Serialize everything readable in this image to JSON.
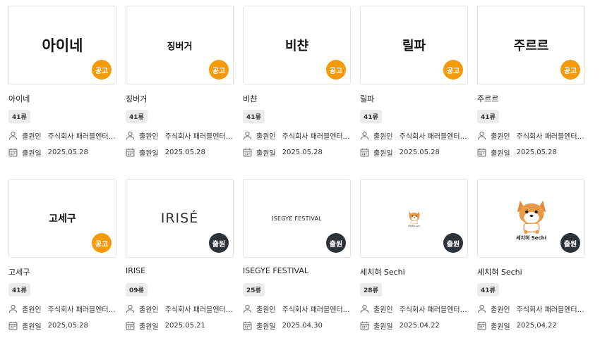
{
  "labels": {
    "applicant": "출원인",
    "filed_date": "출원일"
  },
  "colors": {
    "ad_badge": "#f59a0b",
    "reg_badge": "#2d3238"
  },
  "cards": [
    {
      "thumb": "아이네",
      "badge": "공고",
      "badge_type": "ad",
      "name": "아이네",
      "class": "41류",
      "applicant": "주식회사 패러블엔터테인먼트",
      "date": "2025.05.28"
    },
    {
      "thumb": "징버거",
      "badge": "공고",
      "badge_type": "ad",
      "name": "징버거",
      "class": "41류",
      "applicant": "주식회사 패러블엔터테인먼트",
      "date": "2025.05.28"
    },
    {
      "thumb": "비챤",
      "badge": "공고",
      "badge_type": "ad",
      "name": "비챤",
      "class": "41류",
      "applicant": "주식회사 패러블엔터테인먼트",
      "date": "2025.05.28"
    },
    {
      "thumb": "릴파",
      "badge": "공고",
      "badge_type": "ad",
      "name": "릴파",
      "class": "41류",
      "applicant": "주식회사 패러블엔터테인먼트",
      "date": "2025.05.28"
    },
    {
      "thumb": "주르르",
      "badge": "공고",
      "badge_type": "ad",
      "name": "주르르",
      "class": "41류",
      "applicant": "주식회사 패러블엔터테인먼트",
      "date": "2025.05.28"
    },
    {
      "thumb": "고세구",
      "badge": "공고",
      "badge_type": "ad",
      "name": "고세구",
      "class": "41류",
      "applicant": "주식회사 패러블엔터테인먼트",
      "date": "2025.05.28"
    },
    {
      "thumb": "IRISÉ",
      "badge": "출원",
      "badge_type": "reg",
      "name": "IRISE",
      "class": "09류",
      "applicant": "주식회사 패러블엔터테인먼트",
      "date": "2025.05.21"
    },
    {
      "thumb": "ISEGYE FESTIVAL",
      "badge": "출원",
      "badge_type": "reg",
      "name": "ISEGYE FESTIVAL",
      "class": "25류",
      "applicant": "주식회사 패러블엔터테인먼트",
      "date": "2025.04.30"
    },
    {
      "thumb": "세치혀 Sechi",
      "badge": "출원",
      "badge_type": "reg",
      "name": "세치혀 Sechi",
      "class": "28류",
      "applicant": "주식회사 패러블엔터테인먼트",
      "date": "2025.04.22"
    },
    {
      "thumb": "세치혀 Sechi",
      "badge": "출원",
      "badge_type": "reg",
      "name": "세치혀 Sechi",
      "class": "41류",
      "applicant": "주식회사 패러블엔터테인먼트",
      "date": "2025.04.22"
    }
  ]
}
